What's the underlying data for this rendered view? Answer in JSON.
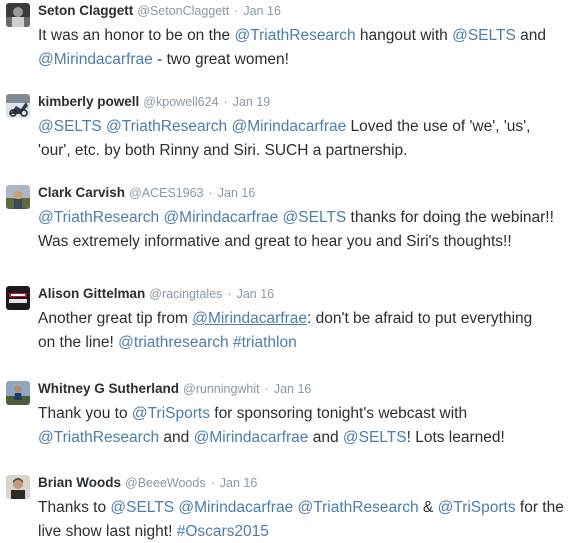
{
  "tweets": [
    {
      "name": "Seton Claggett",
      "handle": "@SetonClaggett",
      "time": "Jan 16",
      "avatar_icon": "user-avatar-dark",
      "lines": [
        [
          {
            "text": "It was an honor to be on the ",
            "type": "text"
          },
          {
            "text": "@TriathResearch",
            "type": "mention"
          },
          {
            "text": " hangout with ",
            "type": "text"
          },
          {
            "text": "@SELTS",
            "type": "mention"
          },
          {
            "text": " and",
            "type": "text"
          }
        ],
        [
          {
            "text": "@Mirindacarfrae",
            "type": "mention"
          },
          {
            "text": " - two great women!",
            "type": "text"
          }
        ]
      ]
    },
    {
      "name": "kimberly powell",
      "handle": "@kpowell624",
      "time": "Jan 19",
      "avatar_icon": "user-avatar-cyclist",
      "lines": [
        [
          {
            "text": "@SELTS",
            "type": "mention"
          },
          {
            "text": " ",
            "type": "text"
          },
          {
            "text": "@TriathResearch",
            "type": "mention"
          },
          {
            "text": " ",
            "type": "text"
          },
          {
            "text": "@Mirindacarfrae",
            "type": "mention"
          },
          {
            "text": " Loved the use of 'we', 'us',",
            "type": "text"
          }
        ],
        [
          {
            "text": "'our', etc. by both Rinny and Siri. SUCH a partnership.",
            "type": "text"
          }
        ]
      ]
    },
    {
      "name": "Clark Carvish",
      "handle": "@ACES1963",
      "time": "Jan 16",
      "avatar_icon": "user-avatar-outdoor",
      "lines": [
        [
          {
            "text": "@TriathResearch",
            "type": "mention"
          },
          {
            "text": " ",
            "type": "text"
          },
          {
            "text": "@Mirindacarfrae",
            "type": "mention"
          },
          {
            "text": " ",
            "type": "text"
          },
          {
            "text": "@SELTS",
            "type": "mention"
          },
          {
            "text": "  thanks for doing the webinar!!",
            "type": "text"
          }
        ],
        [
          {
            "text": "Was extremely informative and great to hear you and Siri's thoughts!!",
            "type": "text"
          }
        ]
      ]
    },
    {
      "name": "Alison Gittelman",
      "handle": "@racingtales",
      "time": "Jan 16",
      "avatar_icon": "user-avatar-logo",
      "lines": [
        [
          {
            "text": "Another great tip from ",
            "type": "text"
          },
          {
            "text": "@Mirindacarfrae",
            "type": "mention-underlined"
          },
          {
            "text": ": don't be afraid to put everything",
            "type": "text"
          }
        ],
        [
          {
            "text": "on the line! ",
            "type": "text"
          },
          {
            "text": "@triathresearch",
            "type": "mention"
          },
          {
            "text": " ",
            "type": "text"
          },
          {
            "text": "#triathlon",
            "type": "tag"
          }
        ]
      ]
    },
    {
      "name": "Whitney G Sutherland",
      "handle": "@runningwhit",
      "time": "Jan 16",
      "avatar_icon": "user-avatar-runner",
      "lines": [
        [
          {
            "text": "Thank you to ",
            "type": "text"
          },
          {
            "text": "@TriSports",
            "type": "mention"
          },
          {
            "text": " for sponsoring tonight's webcast with",
            "type": "text"
          }
        ],
        [
          {
            "text": "@TriathResearch",
            "type": "mention"
          },
          {
            "text": " and ",
            "type": "text"
          },
          {
            "text": "@Mirindacarfrae",
            "type": "mention"
          },
          {
            "text": " and ",
            "type": "text"
          },
          {
            "text": "@SELTS",
            "type": "mention"
          },
          {
            "text": "! Lots learned!",
            "type": "text"
          }
        ]
      ]
    },
    {
      "name": "Brian Woods",
      "handle": "@BeeeWoods",
      "time": "Jan 16",
      "avatar_icon": "user-avatar-portrait",
      "lines": [
        [
          {
            "text": "Thanks to ",
            "type": "text"
          },
          {
            "text": "@SELTS",
            "type": "mention"
          },
          {
            "text": " ",
            "type": "text"
          },
          {
            "text": "@Mirindacarfrae",
            "type": "mention"
          },
          {
            "text": " ",
            "type": "text"
          },
          {
            "text": "@TriathResearch",
            "type": "mention"
          },
          {
            "text": " & ",
            "type": "text"
          },
          {
            "text": "@TriSports",
            "type": "mention"
          },
          {
            "text": " for the",
            "type": "text"
          }
        ],
        [
          {
            "text": "live show last night! ",
            "type": "text"
          },
          {
            "text": "#Oscars2015",
            "type": "tag"
          }
        ]
      ]
    }
  ],
  "separator": "·",
  "colors": {
    "name": "#292f33",
    "meta": "#8899a6",
    "link": "#4b7eaa",
    "text": "#292f33"
  }
}
